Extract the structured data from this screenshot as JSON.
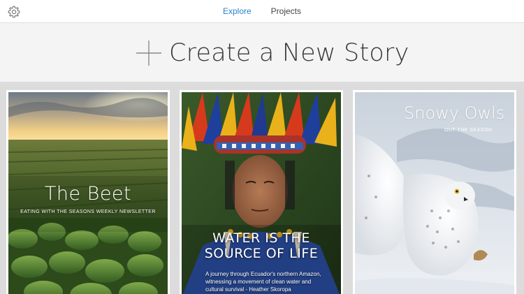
{
  "header": {
    "settings_icon": "gear-icon",
    "tabs": [
      {
        "label": "Explore",
        "active": true
      },
      {
        "label": "Projects",
        "active": false
      }
    ],
    "accent_color": "#2b86c5"
  },
  "create": {
    "icon": "plus-icon",
    "label": "Create a New Story"
  },
  "stories": [
    {
      "title": "The Beet",
      "subtitle": "EATING WITH THE SEASONS WEEKLY NEWSLETTER"
    },
    {
      "title_line1": "WATER IS THE",
      "title_line2": "SOURCE OF LIFE",
      "caption_line1": "A journey through Ecuador's northern Amazon,",
      "caption_line2": "witnessing a movement of clean water and",
      "caption_line3": "cultural survival - Heather Skoropa"
    },
    {
      "title": "Snowy Owls",
      "subtitle": "OUT THE SEASON"
    }
  ]
}
